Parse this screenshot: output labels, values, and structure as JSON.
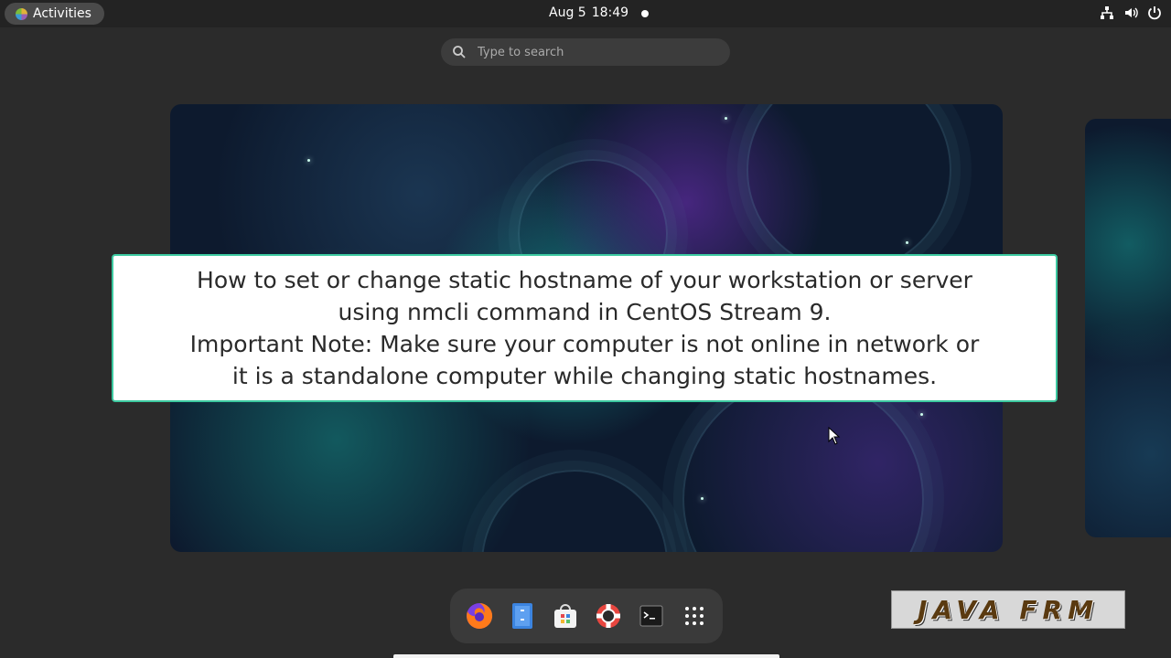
{
  "topbar": {
    "activities_label": "Activities",
    "date": "Aug 5",
    "time": "18:49"
  },
  "search": {
    "placeholder": "Type to search"
  },
  "caption": {
    "lines": [
      "How to set or change static hostname of your workstation or server",
      "using nmcli command in CentOS Stream 9.",
      "Important Note: Make sure your computer is not online in network or",
      "it is a standalone computer while changing static hostnames."
    ]
  },
  "dock": {
    "apps": [
      "firefox-icon",
      "files-icon",
      "software-icon",
      "help-icon",
      "terminal-icon",
      "app-grid-icon"
    ]
  },
  "watermark": {
    "text": "JAVA FRM"
  },
  "colors": {
    "caption_border": "#3cc9a0",
    "background": "#2b2b2b"
  }
}
